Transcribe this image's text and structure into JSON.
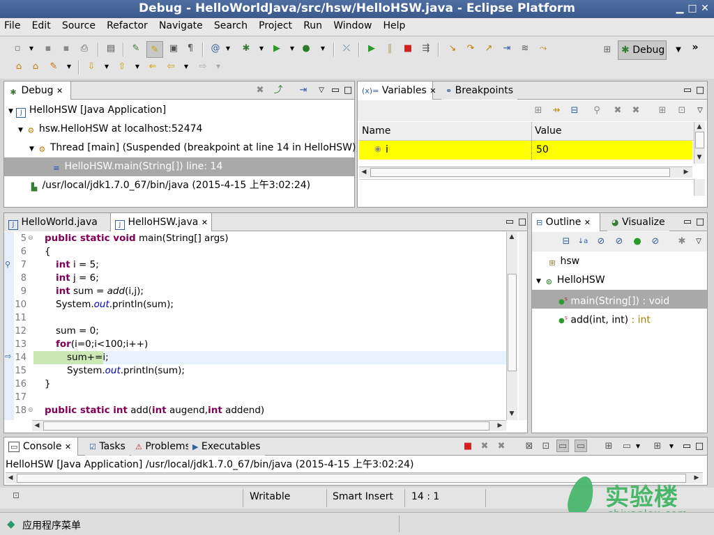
{
  "window": {
    "title": "Debug - HelloWorldJava/src/hsw/HelloHSW.java - Eclipse Platform"
  },
  "menu": [
    "File",
    "Edit",
    "Source",
    "Refactor",
    "Navigate",
    "Search",
    "Project",
    "Run",
    "Window",
    "Help"
  ],
  "perspective": {
    "label": "Debug"
  },
  "debug_view": {
    "tab": "Debug",
    "items": [
      {
        "label": "HelloHSW [Java Application]"
      },
      {
        "label": "hsw.HelloHSW at localhost:52474"
      },
      {
        "label": "Thread [main] (Suspended (breakpoint at line 14 in HelloHSW))"
      },
      {
        "label": "HelloHSW.main(String[]) line: 14"
      },
      {
        "label": "/usr/local/jdk1.7.0_67/bin/java (2015-4-15 上午3:02:24)"
      }
    ]
  },
  "variables_view": {
    "tabs": [
      "Variables",
      "Breakpoints"
    ],
    "columns": [
      "Name",
      "Value"
    ],
    "rows": [
      {
        "name": "i",
        "value": "50"
      }
    ]
  },
  "editor": {
    "tabs": [
      "HelloWorld.java",
      "HelloHSW.java"
    ],
    "line_numbers": [
      "5",
      "6",
      "7",
      "8",
      "9",
      "10",
      "11",
      "12",
      "13",
      "14",
      "15",
      "16",
      "17",
      "18"
    ],
    "current_line": "14"
  },
  "outline_view": {
    "tabs": [
      "Outline",
      "Visualize"
    ],
    "package": "hsw",
    "class": "HelloHSW",
    "members": [
      {
        "name": "main(String[]) : void",
        "type_suffix": ""
      },
      {
        "name": "add(int, int)",
        "type_suffix": " : int"
      }
    ]
  },
  "console_view": {
    "tabs": [
      "Console",
      "Tasks",
      "Problems",
      "Executables"
    ],
    "text": "HelloHSW [Java Application] /usr/local/jdk1.7.0_67/bin/java (2015-4-15 上午3:02:24)"
  },
  "statusbar": {
    "writable": "Writable",
    "insert_mode": "Smart Insert",
    "position": "14 : 1"
  },
  "taskbar": {
    "menu_label": "应用程序菜单"
  },
  "watermark": {
    "brand": "实验楼",
    "domain": "shiyanlou.com"
  },
  "colors": {
    "highlight_yellow": "#ffff00",
    "current_line_green": "#cce8b4",
    "keyword": "#7f0055",
    "title_bar": "#3a5a8d"
  }
}
